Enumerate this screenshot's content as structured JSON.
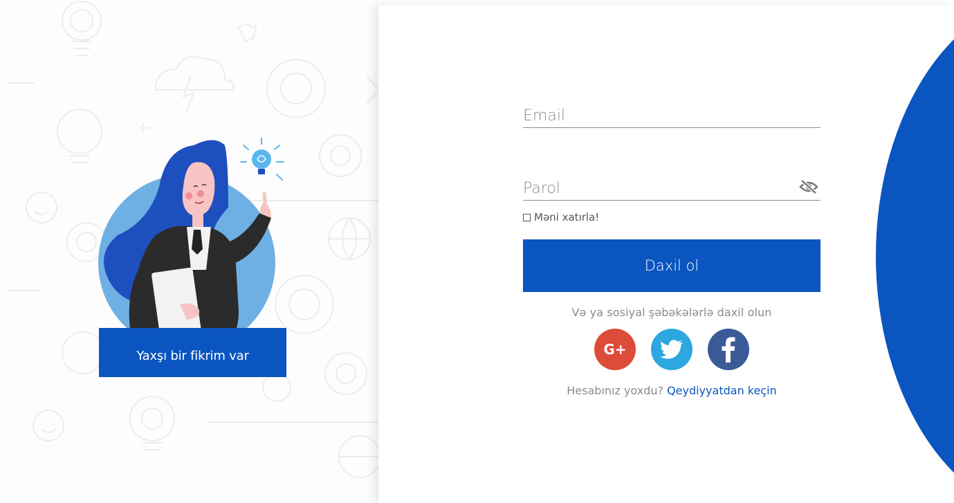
{
  "illustration": {
    "tagline": "Yaxşı bir fikrim var"
  },
  "form": {
    "email_placeholder": "Email",
    "password_placeholder": "Parol",
    "remember_label": "Məni xatırla!",
    "login_label": "Daxil ol",
    "social_text": "Və ya sosiyal şəbəkələrlə daxil olun",
    "signup_prompt": "Hesabınız yoxdu?",
    "signup_link": "Qeydiyyatdan keçin"
  },
  "social": {
    "google_label": "G+"
  },
  "colors": {
    "brand": "#0a55c0",
    "google": "#dd4b39",
    "twitter": "#2ca7e0",
    "facebook": "#3b5a98"
  }
}
